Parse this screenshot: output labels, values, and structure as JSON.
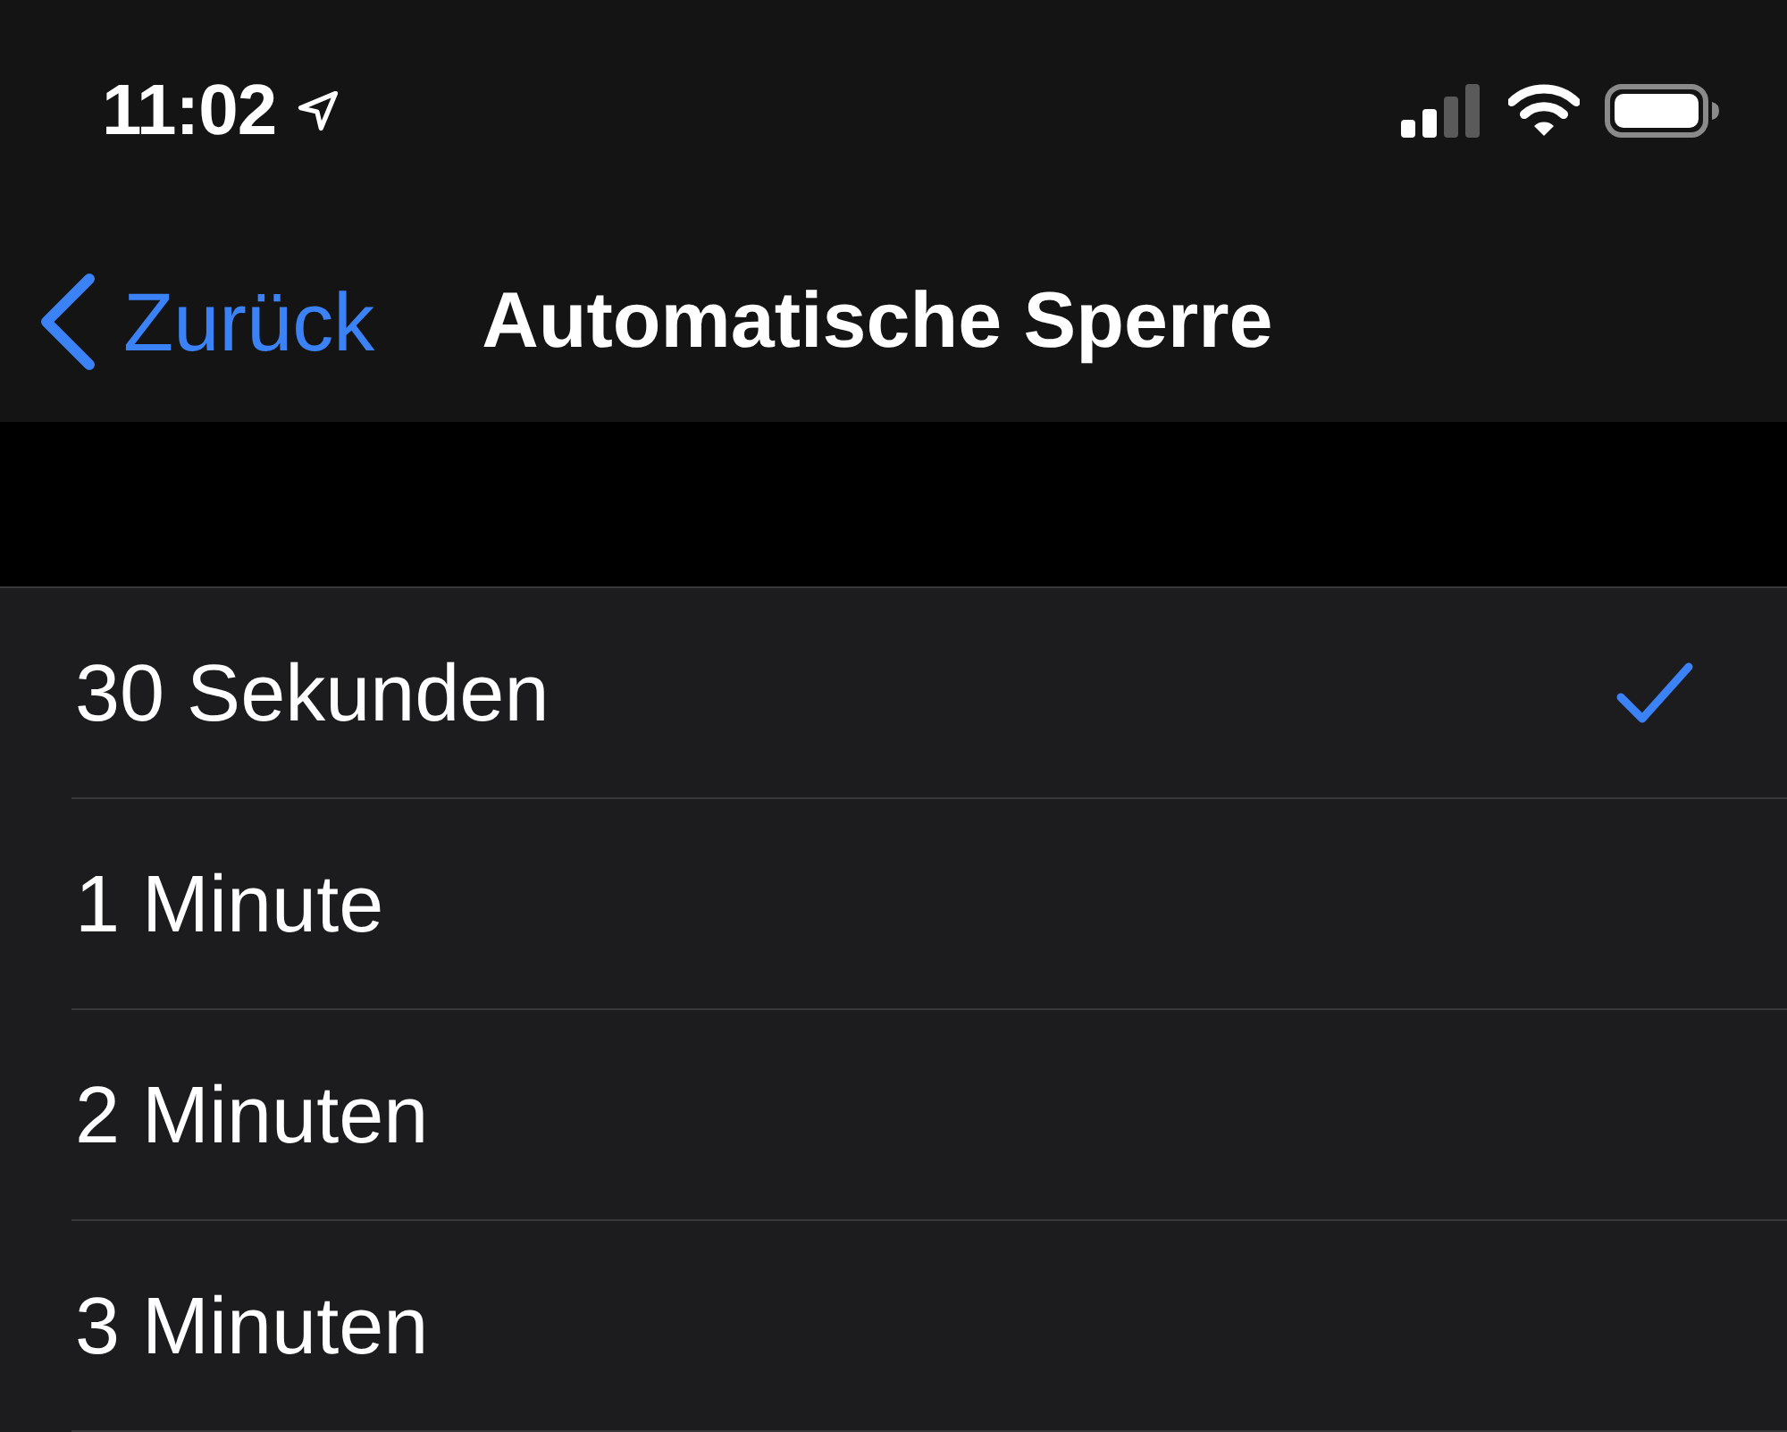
{
  "status_bar": {
    "time": "11:02"
  },
  "nav_bar": {
    "back_label": "Zurück",
    "title": "Automatische Sperre"
  },
  "options": [
    {
      "label": "30 Sekunden",
      "selected": true
    },
    {
      "label": "1 Minute",
      "selected": false
    },
    {
      "label": "2 Minuten",
      "selected": false
    },
    {
      "label": "3 Minuten",
      "selected": false
    }
  ]
}
